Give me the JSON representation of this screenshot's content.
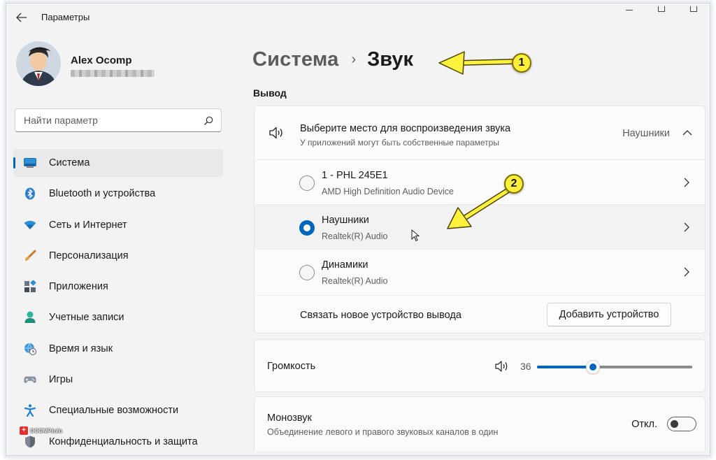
{
  "window": {
    "title": "Параметры"
  },
  "user": {
    "name": "Alex Ocomp"
  },
  "search": {
    "placeholder": "Найти параметр"
  },
  "sidebar": {
    "items": [
      {
        "label": "Система",
        "icon": "system-display-icon",
        "active": true
      },
      {
        "label": "Bluetooth и устройства",
        "icon": "bluetooth-icon"
      },
      {
        "label": "Сеть и Интернет",
        "icon": "wifi-icon"
      },
      {
        "label": "Персонализация",
        "icon": "brush-icon"
      },
      {
        "label": "Приложения",
        "icon": "apps-icon"
      },
      {
        "label": "Учетные записи",
        "icon": "account-icon"
      },
      {
        "label": "Время и язык",
        "icon": "globe-clock-icon"
      },
      {
        "label": "Игры",
        "icon": "gamepad-icon"
      },
      {
        "label": "Специальные возможности",
        "icon": "accessibility-icon"
      },
      {
        "label": "Конфиденциальность и защита",
        "icon": "shield-icon"
      }
    ]
  },
  "watermark": {
    "text": "OCOMP.info"
  },
  "header": {
    "parent": "Система",
    "separator": "›",
    "current": "Звук"
  },
  "output": {
    "section_label": "Вывод",
    "title": "Выберите место для воспроизведения звука",
    "subtitle": "У приложений могут быть собственные параметры",
    "current_device": "Наушники",
    "devices": [
      {
        "name": "1 - PHL 245E1",
        "driver": "AMD High Definition Audio Device",
        "selected": false
      },
      {
        "name": "Наушники",
        "driver": "Realtek(R) Audio",
        "selected": true
      },
      {
        "name": "Динамики",
        "driver": "Realtek(R) Audio",
        "selected": false
      }
    ],
    "pair_label": "Связать новое устройство вывода",
    "add_button": "Добавить устройство"
  },
  "volume": {
    "label": "Громкость",
    "value": 36
  },
  "mono": {
    "title": "Монозвук",
    "subtitle": "Объединение левого и правого звуковых каналов в один",
    "state_label": "Откл.",
    "enabled": false
  },
  "annotations": [
    {
      "number": "1"
    },
    {
      "number": "2"
    }
  ],
  "colors": {
    "accent": "#0067c0",
    "annotation": "#ffef3a"
  }
}
